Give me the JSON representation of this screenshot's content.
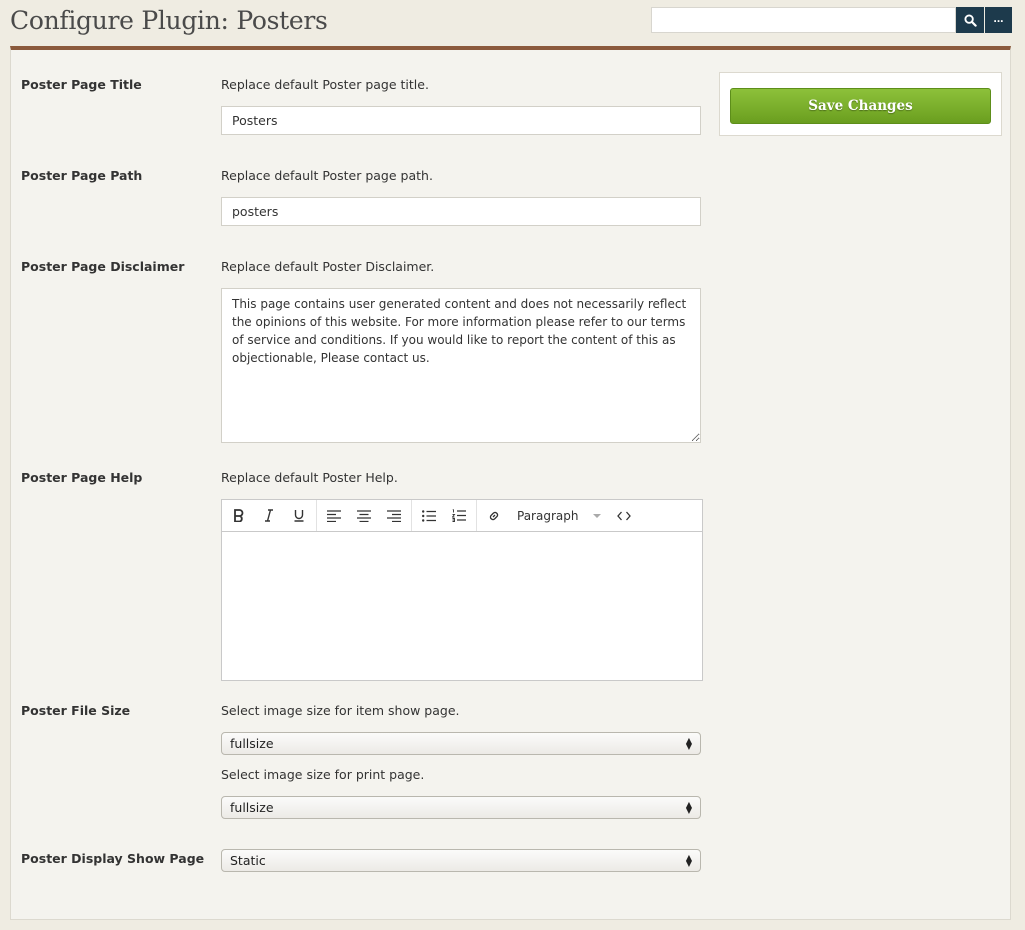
{
  "header": {
    "title": "Configure Plugin: Posters",
    "more_label": "..."
  },
  "search": {
    "placeholder": ""
  },
  "save": {
    "label": "Save Changes"
  },
  "fields": {
    "title": {
      "label": "Poster Page Title",
      "description": "Replace default Poster page title.",
      "value": "Posters"
    },
    "path": {
      "label": "Poster Page Path",
      "description": "Replace default Poster page path.",
      "value": "posters"
    },
    "disclaimer": {
      "label": "Poster Page Disclaimer",
      "description": "Replace default Poster Disclaimer.",
      "value": "This page contains user generated content and does not necessarily reflect the opinions of this website. For more information please refer to our terms of service and conditions. If you would like to report the content of this as objectionable, Please contact us."
    },
    "help": {
      "label": "Poster Page Help",
      "description": "Replace default Poster Help.",
      "format_label": "Paragraph"
    },
    "file_size": {
      "label": "Poster File Size",
      "show_description": "Select image size for item show page.",
      "show_value": "fullsize",
      "print_description": "Select image size for print page.",
      "print_value": "fullsize"
    },
    "display": {
      "label": "Poster Display Show Page",
      "value": "Static"
    }
  },
  "icons": {
    "search": "search-icon",
    "bold": "bold-icon",
    "italic": "italic-icon",
    "underline": "underline-icon",
    "align_left": "align-left-icon",
    "align_center": "align-center-icon",
    "align_right": "align-right-icon",
    "bullet_list": "bullet-list-icon",
    "numbered_list": "numbered-list-icon",
    "link": "link-icon",
    "code": "code-icon"
  },
  "colors": {
    "accent_bar": "#8b5a3c",
    "search_button": "#1d3a4c",
    "save_button": "#7bb02c"
  }
}
